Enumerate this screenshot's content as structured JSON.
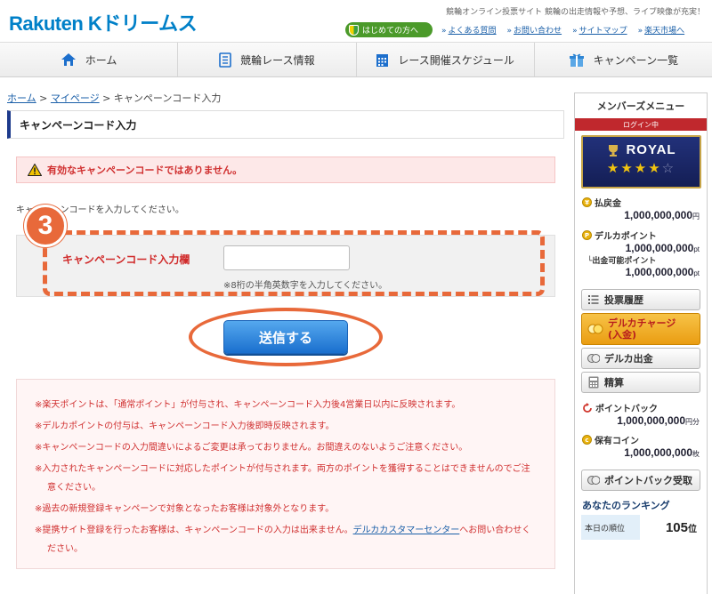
{
  "header": {
    "logo": "Rakuten Kドリームス",
    "tagline": "競輪オンライン投票サイト 競輪の出走情報や予想、ライブ映像が充実！",
    "beginner_label": "はじめての方へ",
    "links": [
      "よくある質問",
      "お問い合わせ",
      "サイトマップ",
      "楽天市場へ"
    ]
  },
  "nav": [
    {
      "label": "ホーム",
      "icon": "home-icon"
    },
    {
      "label": "競輪レース情報",
      "icon": "document-icon"
    },
    {
      "label": "レース開催スケジュール",
      "icon": "calendar-icon"
    },
    {
      "label": "キャンペーン一覧",
      "icon": "gift-icon"
    }
  ],
  "breadcrumb": {
    "home": "ホーム",
    "sep1": ">",
    "mypage": "マイページ",
    "sep2": ">",
    "current": "キャンペーンコード入力"
  },
  "page_title": "キャンペーンコード入力",
  "error_message": "有効なキャンペーンコードではありません。",
  "instruction": "キャンペーンコードを入力してください。",
  "form": {
    "step": "3",
    "label": "キャンペーンコード入力欄",
    "value": "",
    "placeholder": "",
    "hint": "※8桁の半角英数字を入力してください。",
    "submit_label": "送信する"
  },
  "notes": [
    "※楽天ポイントは、「通常ポイント」が付与され、キャンペーンコード入力後4営業日以内に反映されます。",
    "※デルカポイントの付与は、キャンペーンコード入力後即時反映されます。",
    "※キャンペーンコードの入力間違いによるご変更は承っておりません。お間違えのないようご注意ください。",
    "※入力されたキャンペーンコードに対応したポイントが付与されます。両方のポイントを獲得することはできませんのでご注意ください。",
    "※過去の新規登録キャンペーンで対象となったお客様は対象外となります。"
  ],
  "note_last": {
    "before": "※提携サイト登録を行ったお客様は、キャンペーンコードの入力は出来ません。",
    "link": "デルカカスタマーセンター",
    "after": "へお問い合わせください。"
  },
  "sidebar": {
    "title": "メンバーズメニュー",
    "login_status": "ログイン中",
    "rank_name": "ROYAL",
    "rank_stars": 4,
    "rank_stars_max": 5,
    "payout_label": "払戻金",
    "payout_value": "1,000,000,000",
    "payout_unit": "円",
    "delca_points_label": "デルカポイント",
    "delca_points_value": "1,000,000,000",
    "delca_points_unit": "pt",
    "withdrawable_label": "└出金可能ポイント",
    "withdrawable_value": "1,000,000,000",
    "withdrawable_unit": "pt",
    "btn_history": "投票履歴",
    "btn_charge_line1": "デルカチャージ",
    "btn_charge_line2": "(入金)",
    "btn_withdraw": "デルカ出金",
    "btn_settle": "精算",
    "pointback_label": "ポイントバック",
    "pointback_value": "1,000,000,000",
    "pointback_unit": "円分",
    "coins_label": "保有コイン",
    "coins_value": "1,000,000,000",
    "coins_unit": "枚",
    "btn_pointback_receive": "ポイントバック受取",
    "ranking_title": "あなたのランキング",
    "ranking_today_label": "本日の順位",
    "ranking_today_value": "105",
    "ranking_today_unit": "位"
  },
  "colors": {
    "brand_blue": "#0080c8",
    "accent_orange": "#e8693a",
    "error_red": "#d03030",
    "royal_navy": "#1d2a6e"
  }
}
